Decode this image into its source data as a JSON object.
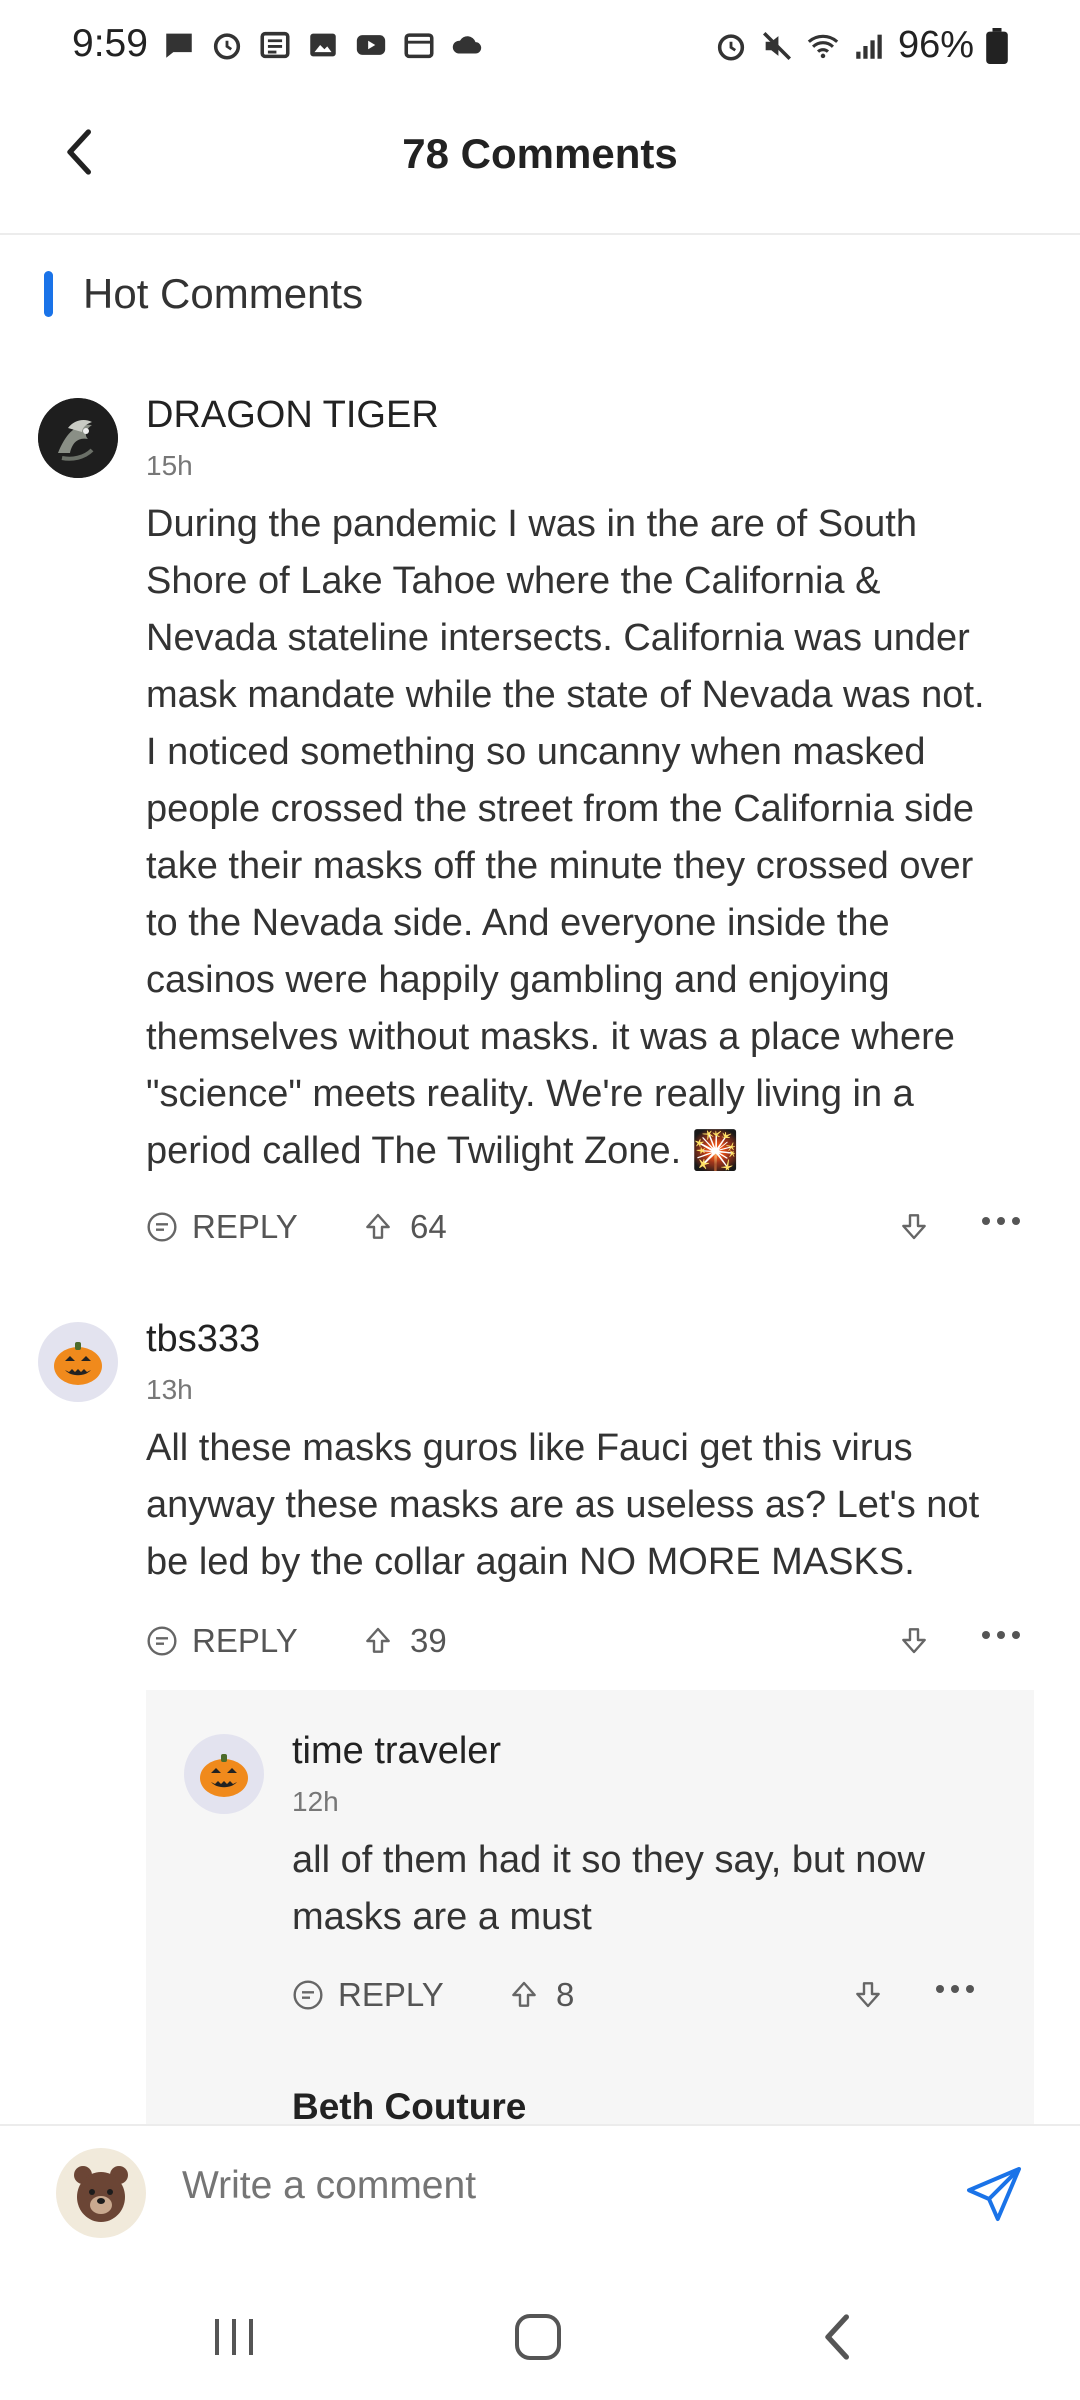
{
  "status_bar": {
    "time": "9:59",
    "battery": "96%"
  },
  "header": {
    "title": "78 Comments"
  },
  "section": {
    "title": "Hot Comments"
  },
  "comments": [
    {
      "author": "DRAGON TIGER",
      "time": "15h",
      "lines": [
        "During the pandemic I was in the are of  South",
        "Shore of Lake Tahoe where the California &",
        "Nevada stateline intersects. California was under",
        "mask mandate while the state of Nevada was not.",
        "I noticed something so uncanny when masked",
        "people crossed the street from the California side",
        "take their masks off the minute they crossed over",
        "to the Nevada side. And everyone inside the",
        "casinos were happily gambling and enjoying",
        "themselves without masks. it was a place where",
        "\"science\" meets reality. We're really living in a",
        "period called The Twilight Zone. 🎇"
      ],
      "reply_label": "REPLY",
      "upvotes": "64"
    },
    {
      "author": "tbs333",
      "time": "13h",
      "lines": [
        "All these masks guros like Fauci get this virus",
        "anyway these masks are as useless as?   Let's not",
        "be led by the collar again NO MORE MASKS."
      ],
      "reply_label": "REPLY",
      "upvotes": "39"
    }
  ],
  "replies": [
    {
      "author": "time traveler",
      "time": "12h",
      "lines": [
        "all of them had it so they say, but now",
        "masks are a must"
      ],
      "reply_label": "REPLY",
      "upvotes": "8"
    },
    {
      "author": "Beth Couture"
    }
  ],
  "composer": {
    "placeholder": "Write a comment"
  },
  "colors": {
    "accent": "#1a73e8",
    "reply_background": "#f6f6f6",
    "avatar_background": "#e3e3ef"
  },
  "icons": {
    "back": "chevron-left-icon",
    "reply": "reply-icon",
    "upvote": "arrow-up-icon",
    "downvote": "arrow-down-icon",
    "more": "more-horizontal-icon",
    "send": "send-icon"
  }
}
